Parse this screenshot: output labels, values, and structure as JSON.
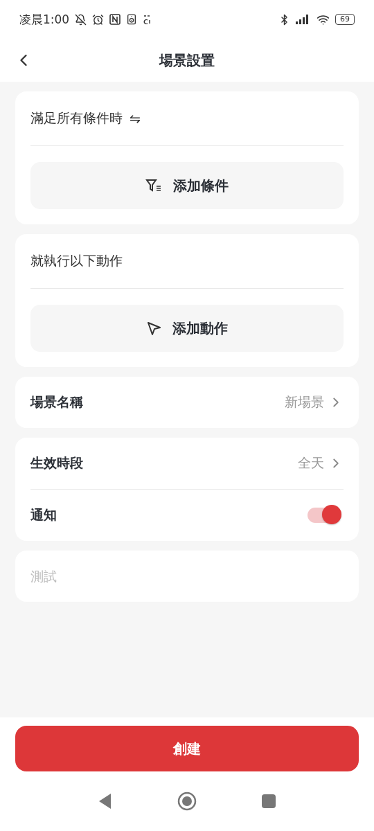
{
  "status_bar": {
    "time": "凌晨1:00",
    "battery": "69"
  },
  "header": {
    "title": "場景設置"
  },
  "condition_card": {
    "title": "滿足所有條件時",
    "mode_symbol": "⇋",
    "button": "添加條件"
  },
  "action_card": {
    "title": "就執行以下動作",
    "button": "添加動作"
  },
  "settings_groups": [
    [
      {
        "kind": "link",
        "label": "場景名稱",
        "value": "新場景"
      }
    ],
    [
      {
        "kind": "link",
        "label": "生效時段",
        "value": "全天"
      },
      {
        "kind": "toggle",
        "label": "通知",
        "on": true
      }
    ]
  ],
  "note_field": {
    "placeholder": "測試"
  },
  "create_button": "創建"
}
